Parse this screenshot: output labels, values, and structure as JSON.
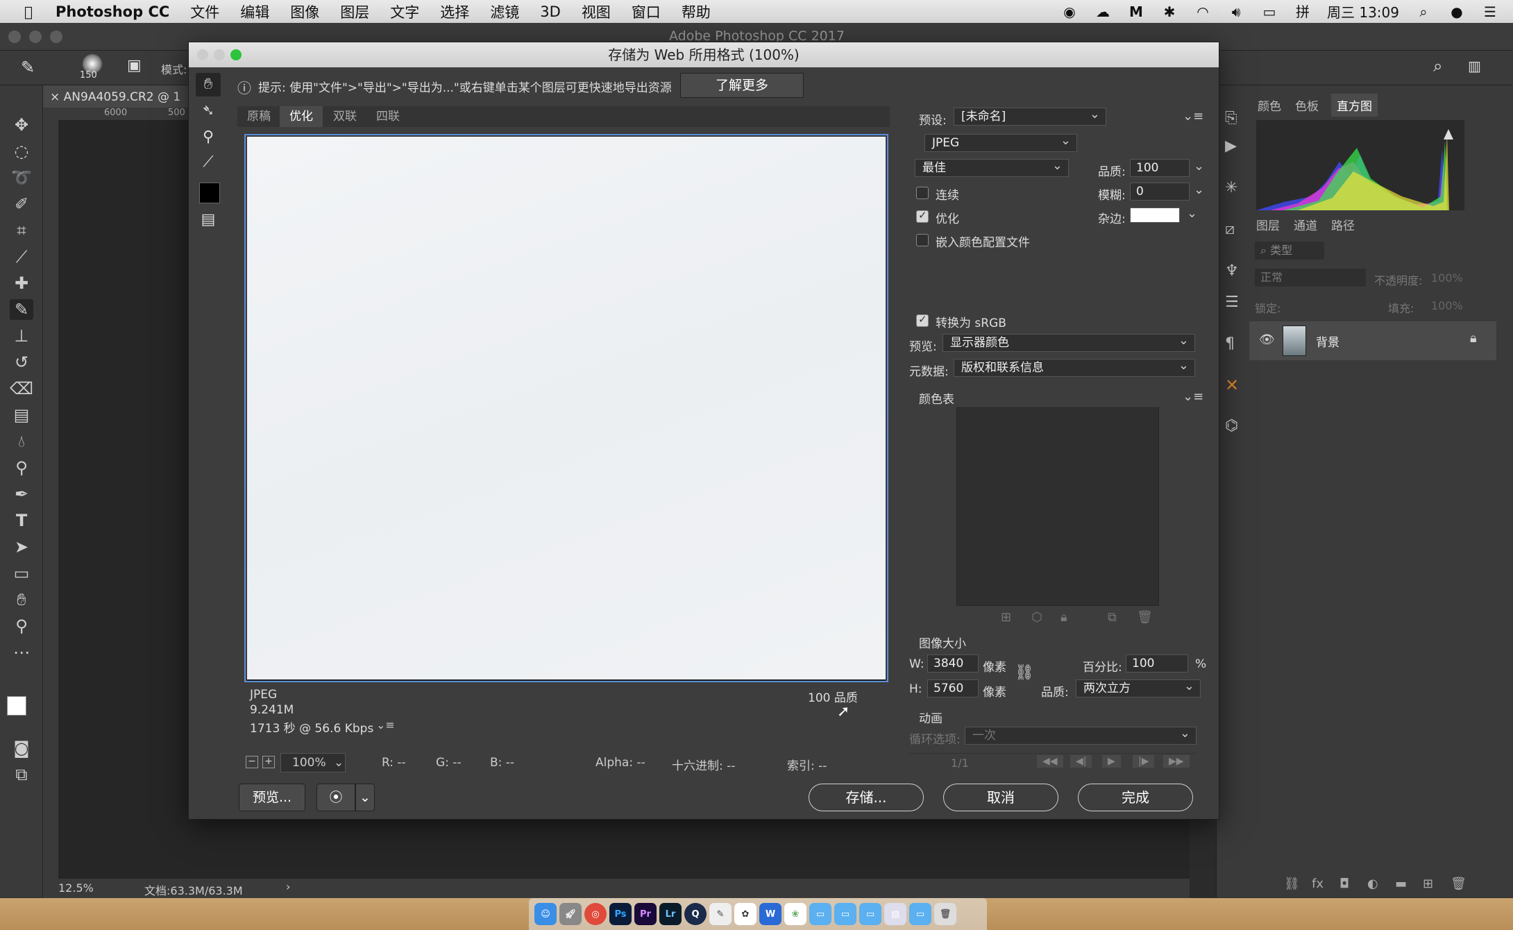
{
  "menubar": {
    "app": "Photoshop CC",
    "items": [
      "文件",
      "编辑",
      "图像",
      "图层",
      "文字",
      "选择",
      "滤镜",
      "3D",
      "视图",
      "窗口",
      "帮助"
    ],
    "clock": "周三 13:09"
  },
  "ps": {
    "window_title": "Adobe Photoshop CC 2017",
    "doc_tab": "AN9A4059.CR2 @ 1",
    "mode_label": "模式:",
    "brush_size": "150",
    "ruler_marks": [
      "6000",
      "500"
    ],
    "zoom": "12.5%",
    "doc_info": "文档:63.3M/63.3M",
    "status_arrow": "›"
  },
  "panels": {
    "top_tabs": [
      "颜色",
      "色板",
      "直方图"
    ],
    "layer_tabs": [
      "图层",
      "通道",
      "路径"
    ],
    "filter_placeholder": "类型",
    "blend_mode": "正常",
    "opacity_label": "不透明度:",
    "opacity_value": "100%",
    "lock_label": "锁定:",
    "fill_label": "填充:",
    "fill_value": "100%",
    "layer_name": "背景"
  },
  "dialog": {
    "title": "存储为 Web 所用格式 (100%)",
    "tip": "提示: 使用\"文件\">\"导出\">\"导出为...\"或右键单击某个图层可更快速地导出资源",
    "learn_more": "了解更多",
    "view_tabs": [
      "原稿",
      "优化",
      "双联",
      "四联"
    ],
    "active_tab": "优化",
    "preview_info": {
      "format": "JPEG",
      "size": "9.241M",
      "time": "1713 秒 @ 56.6 Kbps",
      "quality": "100 品质"
    },
    "zoom": {
      "level": "100%",
      "r": "R: --",
      "g": "G: --",
      "b": "B: --",
      "alpha": "Alpha: --",
      "hex": "十六进制: --",
      "index": "索引: --"
    },
    "buttons": {
      "preview": "预览...",
      "save": "存储...",
      "cancel": "取消",
      "done": "完成"
    },
    "settings": {
      "preset_label": "预设:",
      "preset_value": "[未命名]",
      "format_value": "JPEG",
      "quality_preset": "最佳",
      "quality_label": "品质:",
      "quality_value": "100",
      "blur_label": "模糊:",
      "blur_value": "0",
      "matte_label": "杂边:",
      "progressive": "连续",
      "optimized": "优化",
      "embed_profile": "嵌入颜色配置文件",
      "convert_srgb": "转换为 sRGB",
      "preview_label": "预览:",
      "preview_value": "显示器颜色",
      "metadata_label": "元数据:",
      "metadata_value": "版权和联系信息",
      "color_table": "颜色表",
      "image_size": "图像大小",
      "w_label": "W:",
      "w_value": "3840",
      "h_label": "H:",
      "h_value": "5760",
      "unit": "像素",
      "percent_label": "百分比:",
      "percent_value": "100",
      "percent_sign": "%",
      "resample_label": "品质:",
      "resample_value": "两次立方",
      "animation": "动画",
      "loop_label": "循环选项:",
      "loop_value": "一次",
      "frame": "1/1"
    }
  }
}
